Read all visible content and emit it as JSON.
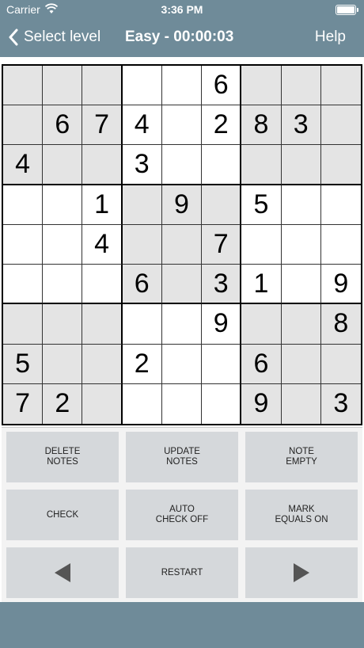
{
  "status_bar": {
    "carrier": "Carrier",
    "time": "3:36 PM"
  },
  "nav": {
    "back_label": "Select level",
    "title": "Easy - 00:00:03",
    "help_label": "Help"
  },
  "grid": {
    "values": [
      [
        "",
        "",
        "",
        "",
        "",
        "6",
        "",
        "",
        ""
      ],
      [
        "",
        "6",
        "7",
        "4",
        "",
        "2",
        "8",
        "3",
        ""
      ],
      [
        "4",
        "",
        "",
        "3",
        "",
        "",
        "",
        "",
        ""
      ],
      [
        "",
        "",
        "1",
        "",
        "9",
        "",
        "5",
        "",
        ""
      ],
      [
        "",
        "",
        "4",
        "",
        "",
        "7",
        "",
        "",
        ""
      ],
      [
        "",
        "",
        "",
        "6",
        "",
        "3",
        "1",
        "",
        "9"
      ],
      [
        "",
        "",
        "",
        "",
        "",
        "9",
        "",
        "",
        "8"
      ],
      [
        "5",
        "",
        "",
        "2",
        "",
        "",
        "6",
        "",
        ""
      ],
      [
        "7",
        "2",
        "",
        "",
        "",
        "",
        "9",
        "",
        "3"
      ]
    ],
    "shaded_box_color": "#e4e4e4"
  },
  "controls": {
    "delete_notes": "DELETE\nNOTES",
    "update_notes": "UPDATE\nNOTES",
    "note_empty": "NOTE\nEMPTY",
    "check": "CHECK",
    "auto_check": "AUTO\nCHECK OFF",
    "mark_equals": "MARK\nEQUALS ON",
    "restart": "RESTART"
  },
  "colors": {
    "bar": "#6f8b99",
    "button": "#d5d8db"
  }
}
